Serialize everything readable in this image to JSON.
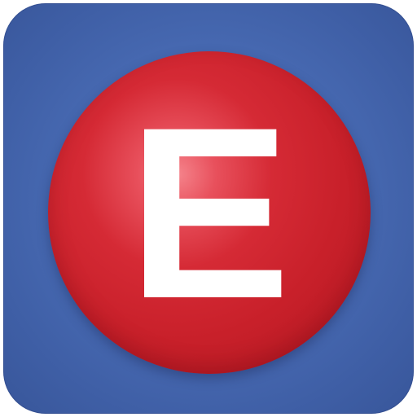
{
  "icon": {
    "letter": "E",
    "colors": {
      "tile_background": "#4a6db6",
      "ball": "#d52a35",
      "ball_highlight": "#f5848c",
      "letter": "#ffffff"
    }
  }
}
